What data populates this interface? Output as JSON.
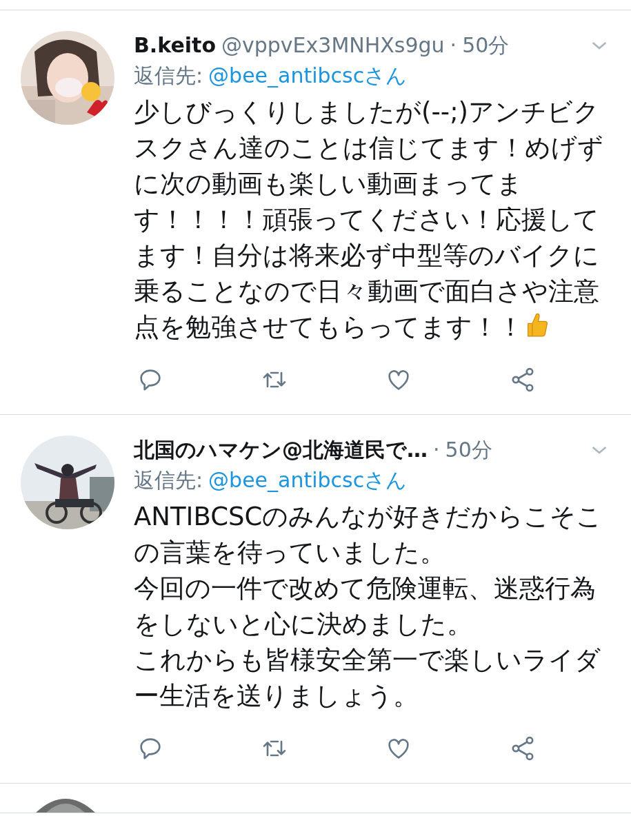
{
  "tweets": [
    {
      "name": "B.keito",
      "handle": "@vppvEx3MNHXs9gu",
      "separator": "·",
      "time": "50分",
      "reply_label": "返信先:",
      "reply_to": "@bee_antibcscさん",
      "paragraphs": [
        "少しびっくりしましたが(--;)アンチビクスクさん達のことは信じてます！めげずに次の動画も楽しい動画まってます！！！！頑張ってください！応援してます！自分は将来必ず中型等のバイクに乗ることなので日々動画で面白さや注意点を勉強させてもらってます！！"
      ],
      "ends_with_thumbs_up": true
    },
    {
      "name": "北国のハマケン@北海道民で…",
      "separator": "·",
      "time": "50分",
      "reply_label": "返信先:",
      "reply_to": "@bee_antibcscさん",
      "paragraphs": [
        "ANTIBCSCのみんなが好きだからこそこの言葉を待っていました。",
        "今回の一件で改めて危険運転、迷惑行為をしないと心に決めました。",
        "これからも皆様安全第一で楽しいライダー生活を送りましょう。"
      ],
      "ends_with_thumbs_up": false
    }
  ]
}
